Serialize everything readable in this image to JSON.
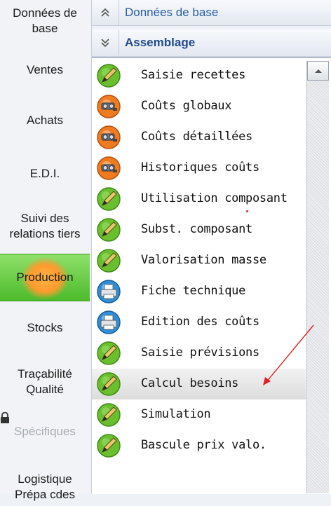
{
  "nav": [
    {
      "label": "Données de base"
    },
    {
      "label": "Ventes"
    },
    {
      "label": "Achats"
    },
    {
      "label": "E.D.I."
    },
    {
      "label": "Suivi des relations tiers"
    },
    {
      "label": "Production",
      "active": true
    },
    {
      "label": "Stocks"
    },
    {
      "label": "Traçabilité Qualité"
    },
    {
      "label": "Spécifiques",
      "disabled": true
    },
    {
      "label": "Logistique Prépa cdes"
    }
  ],
  "sections": {
    "collapsed": {
      "title": "Données de base",
      "icon": "chevron-up-double-icon"
    },
    "expanded": {
      "title": "Assemblage",
      "icon": "chevron-down-double-icon"
    }
  },
  "items": [
    {
      "label": "Saisie recettes",
      "icon": "green-pen-icon"
    },
    {
      "label": "Coûts globaux",
      "icon": "orange-gear-icon"
    },
    {
      "label": "Coûts détaillées",
      "icon": "orange-gear-icon"
    },
    {
      "label": "Historiques coûts",
      "icon": "orange-gear-icon"
    },
    {
      "label": "Utilisation composant",
      "icon": "green-pen-icon"
    },
    {
      "label": "Subst. composant",
      "icon": "green-pen-icon"
    },
    {
      "label": "Valorisation masse",
      "icon": "green-pen-icon"
    },
    {
      "label": "Fiche technique",
      "icon": "blue-printer-icon"
    },
    {
      "label": "Edition des coûts",
      "icon": "blue-printer-icon"
    },
    {
      "label": "Saisie prévisions",
      "icon": "green-pen-icon"
    },
    {
      "label": "Calcul besoins",
      "icon": "green-pen-icon",
      "selected": true
    },
    {
      "label": "Simulation",
      "icon": "green-pen-icon"
    },
    {
      "label": "Bascule prix valo.",
      "icon": "green-pen-icon"
    }
  ],
  "colors": {
    "accent": "#2a5ea8",
    "active_nav": "#4dbb2b",
    "annotation": "#e02020"
  }
}
